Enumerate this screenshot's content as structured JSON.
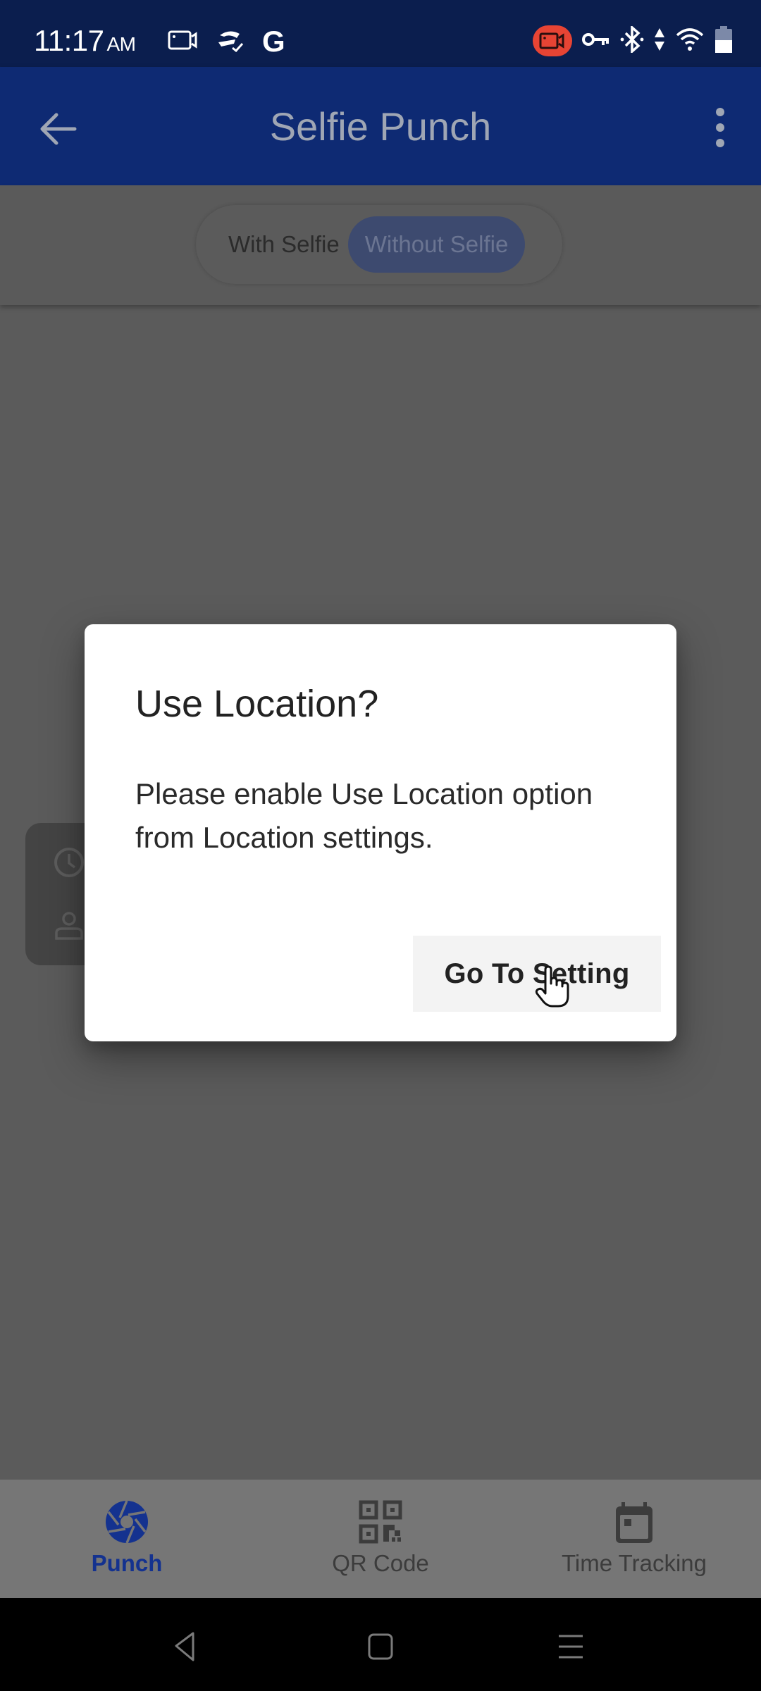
{
  "status_bar": {
    "time": "11:17",
    "ampm": "AM",
    "left_icons": [
      "screen-record-icon",
      "sync-check-icon",
      "google-icon"
    ],
    "google_letter": "G",
    "right_icons": [
      "recording-indicator-icon",
      "vpn-key-icon",
      "bluetooth-icon",
      "data-arrows-icon",
      "wifi-icon",
      "battery-icon"
    ],
    "recording_color": "#e74434",
    "battery_percent": 55
  },
  "app_bar": {
    "title": "Selfie Punch",
    "back_icon": "arrow-left-icon",
    "menu_icon": "more-vertical-icon",
    "color": "#0e2a73"
  },
  "mode_toggle": {
    "options": [
      {
        "label": "With Selfie",
        "selected": false
      },
      {
        "label": "Without Selfie",
        "selected": true
      }
    ]
  },
  "background_card": {
    "icons": [
      "clock-icon",
      "person-icon"
    ]
  },
  "dialog": {
    "title": "Use Location?",
    "message": "Please enable Use Location option from Location settings.",
    "action_label": "Go To Setting"
  },
  "bottom_nav": {
    "active_color": "#14328f",
    "items": [
      {
        "label": "Punch",
        "icon": "camera-shutter-icon",
        "active": true
      },
      {
        "label": "QR Code",
        "icon": "qr-code-icon",
        "active": false
      },
      {
        "label": "Time Tracking",
        "icon": "calendar-icon",
        "active": false
      }
    ]
  },
  "system_nav": {
    "buttons": [
      "back-icon",
      "home-icon",
      "recents-icon"
    ]
  }
}
